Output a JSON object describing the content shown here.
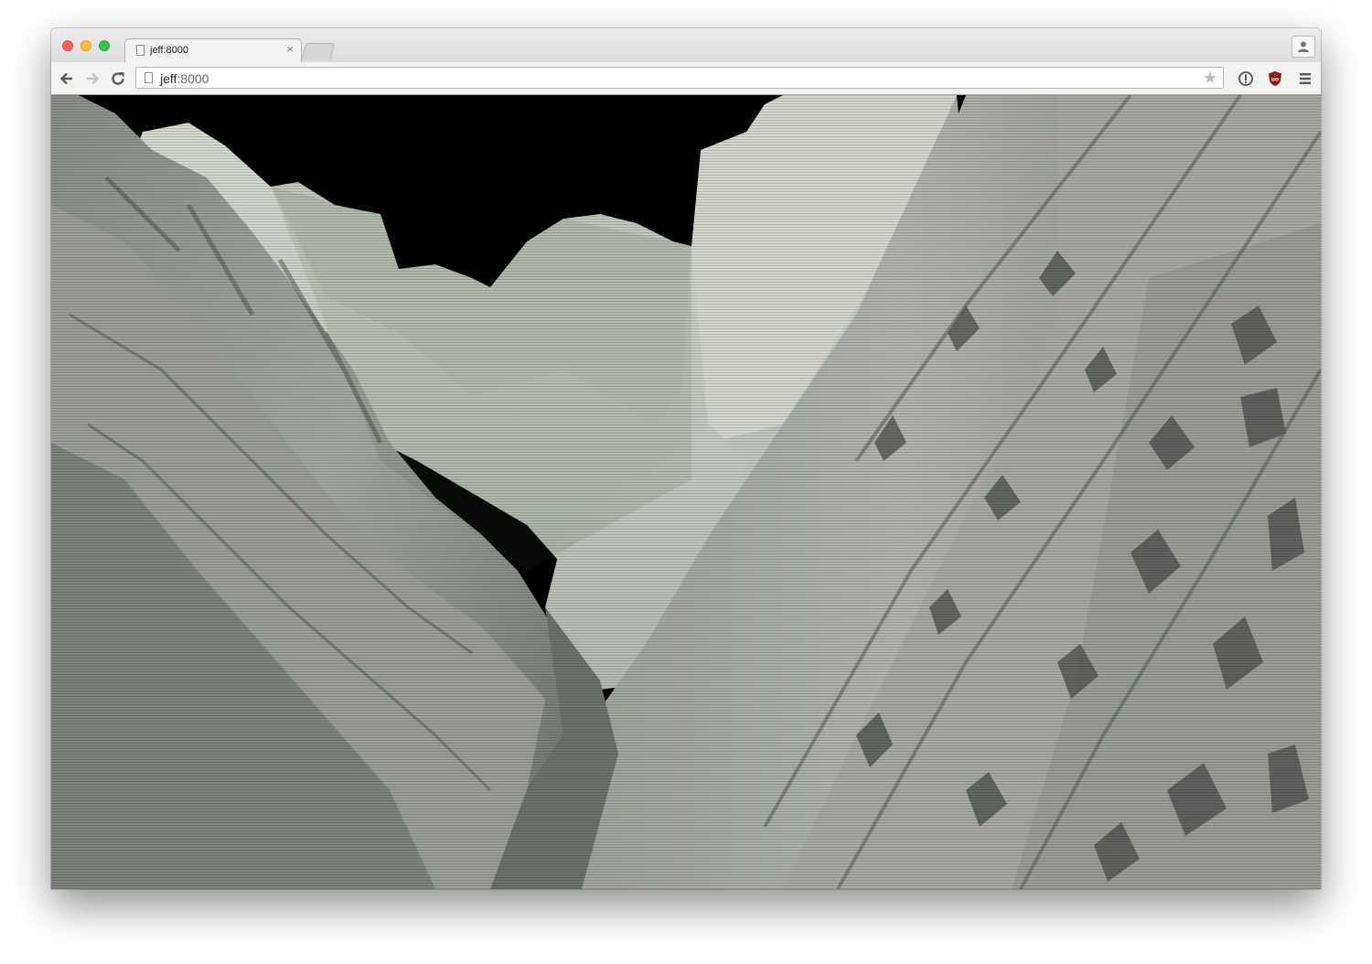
{
  "browser": {
    "tab": {
      "title": "jeff:8000"
    },
    "address_bar": {
      "host": "jeff",
      "port": ":8000"
    },
    "icons": {
      "tab_page": "page-icon",
      "tab_close": "close-icon",
      "back": "back-arrow-icon",
      "forward": "forward-arrow-icon",
      "reload": "reload-icon",
      "omnibox_page": "page-icon",
      "bookmark": "star-icon",
      "extension_1": "info-circle-icon",
      "extension_2": "ublock-shield-icon",
      "menu": "hamburger-menu-icon",
      "profile": "person-icon"
    },
    "tab_close_glyph": "×",
    "star_glyph": "★"
  },
  "canvas": {
    "description_colors": {
      "sky": "#000000",
      "terrain_light": "#c9cdc6",
      "terrain_mid": "#8e938c",
      "terrain_dark": "#4a4d49",
      "green_tint": "#3e5a3a"
    }
  }
}
